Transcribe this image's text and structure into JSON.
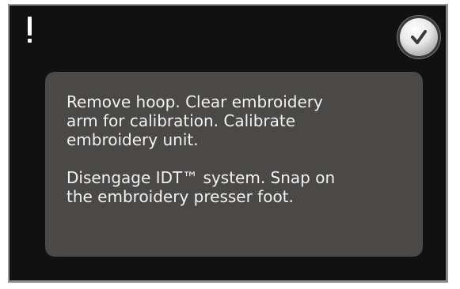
{
  "dialog": {
    "alert_icon": "exclamation-icon",
    "ok_icon": "checkmark-icon",
    "message": "Remove hoop. Clear embroidery\narm for calibration. Calibrate\nembroidery unit.\n\nDisengage IDT™ system. Snap on\nthe embroidery presser foot."
  },
  "colors": {
    "screen_background": "#111111",
    "panel_background": "#4a4947",
    "text": "#f2f2f2",
    "check_mark": "#3a3a3a"
  }
}
